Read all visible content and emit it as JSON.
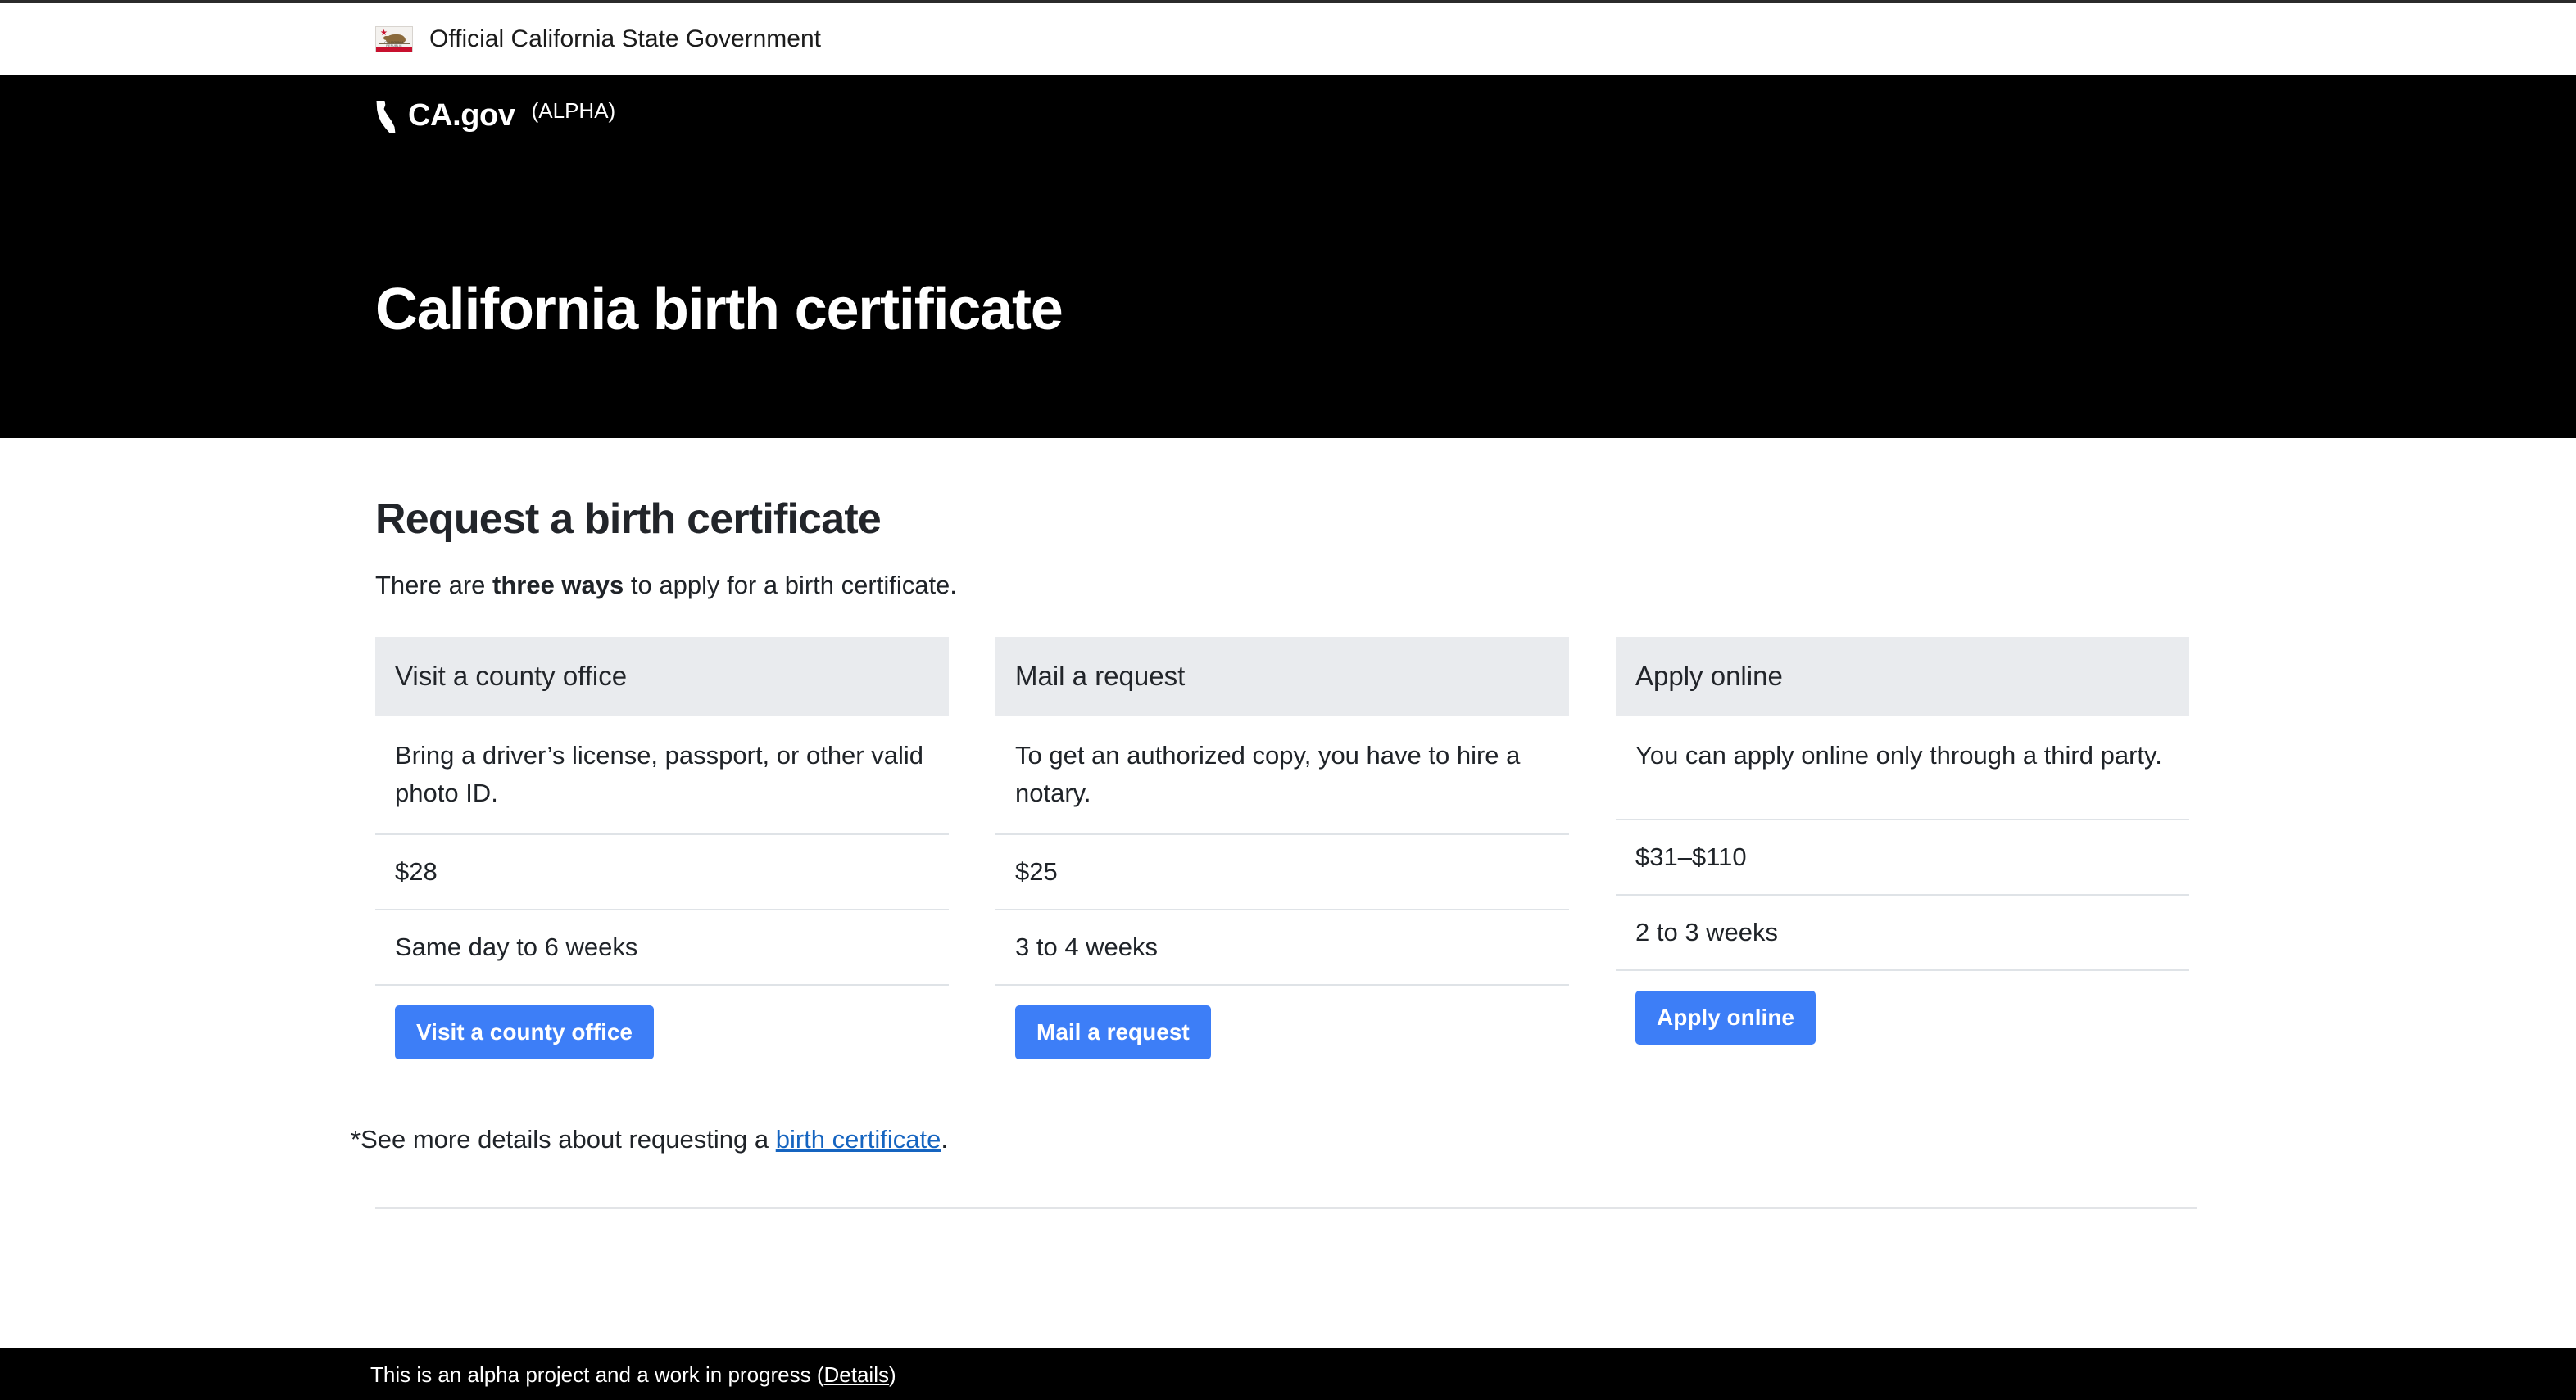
{
  "state_banner": {
    "flag_icon": "california-flag-icon",
    "flag_caption": "CALIFORNIA REPUBLIC",
    "text": "Official California State Government"
  },
  "hero": {
    "logo_icon": "california-outline-icon",
    "brand": "CA.gov",
    "brand_tag": "(ALPHA)",
    "title": "California birth certificate"
  },
  "main": {
    "section_title": "Request a birth certificate",
    "intro_before": "There are ",
    "intro_bold": "three ways",
    "intro_after": " to apply for a birth certificate.",
    "cards": [
      {
        "header": "Visit a county office",
        "description": "Bring a driver’s license, passport, or other valid photo ID.",
        "price": "$28",
        "time": "Same day to 6 weeks",
        "button": "Visit a county office"
      },
      {
        "header": "Mail a request",
        "description": "To get an authorized copy, you have to hire a notary.",
        "price": "$25",
        "time": "3 to 4 weeks",
        "button": "Mail a request"
      },
      {
        "header": "Apply online",
        "description": "You can apply online only through a third party.",
        "price": "$31–$110",
        "time": "2 to 3 weeks",
        "button": "Apply online"
      }
    ],
    "footnote_before": "*See more details about requesting a ",
    "footnote_link": "birth certificate",
    "footnote_after": "."
  },
  "footer": {
    "text_before": "This is an alpha project and a work in progress (",
    "link": "Details",
    "text_after": ")"
  },
  "colors": {
    "hero_background": "#000000",
    "card_header": "#e9ebee",
    "button": "#3d7ef7",
    "link": "#1564c0",
    "flag_red": "#c8102e"
  }
}
